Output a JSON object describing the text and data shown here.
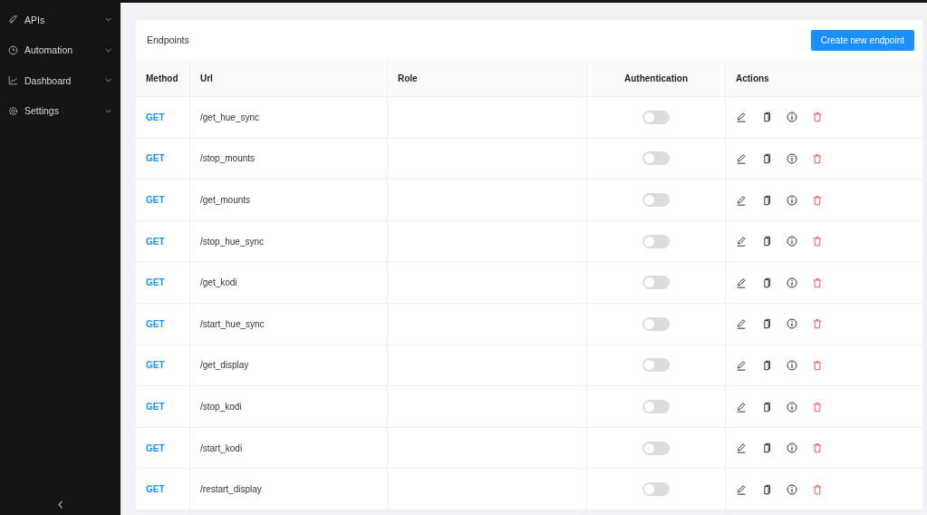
{
  "sidebar": {
    "items": [
      {
        "label": "APIs"
      },
      {
        "label": "Automation"
      },
      {
        "label": "Dashboard"
      },
      {
        "label": "Settings"
      }
    ]
  },
  "card": {
    "title": "Endpoints",
    "button": "Create new endpoint"
  },
  "table": {
    "columns": [
      "Method",
      "Url",
      "Role",
      "Authentication",
      "Actions"
    ],
    "rows": [
      {
        "method": "GET",
        "url": "/get_hue_sync",
        "authentication": false
      },
      {
        "method": "GET",
        "url": "/stop_mounts",
        "authentication": false
      },
      {
        "method": "GET",
        "url": "/get_mounts",
        "authentication": false
      },
      {
        "method": "GET",
        "url": "/stop_hue_sync",
        "authentication": false
      },
      {
        "method": "GET",
        "url": "/get_kodi",
        "authentication": false
      },
      {
        "method": "GET",
        "url": "/start_hue_sync",
        "authentication": false
      },
      {
        "method": "GET",
        "url": "/get_display",
        "authentication": false
      },
      {
        "method": "GET",
        "url": "/stop_kodi",
        "authentication": false
      },
      {
        "method": "GET",
        "url": "/start_kodi",
        "authentication": false
      },
      {
        "method": "GET",
        "url": "/restart_display",
        "authentication": false
      }
    ]
  }
}
